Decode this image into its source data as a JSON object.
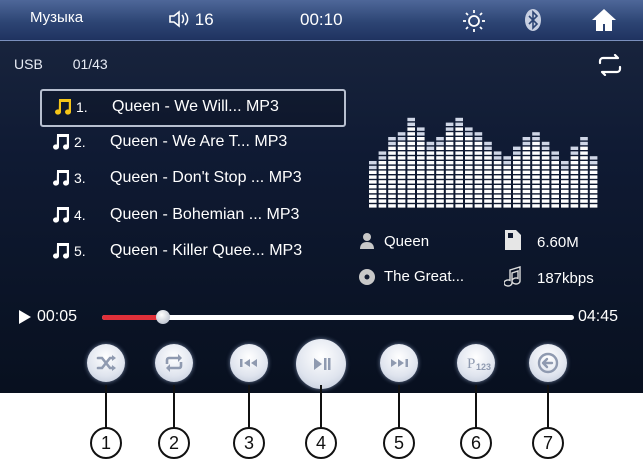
{
  "status_bar": {
    "title": "Музыка",
    "volume": "16",
    "time": "00:10",
    "icons": [
      "speaker-icon",
      "brightness-icon",
      "bluetooth-icon",
      "home-icon"
    ]
  },
  "source": {
    "name": "USB",
    "track_position": "01/43"
  },
  "playlist": [
    {
      "num": "1.",
      "title": "Queen - We Will... MP3",
      "selected": true
    },
    {
      "num": "2.",
      "title": "Queen - We Are T... MP3",
      "selected": false
    },
    {
      "num": "3.",
      "title": "Queen - Don't Stop ... MP3",
      "selected": false
    },
    {
      "num": "4.",
      "title": "Queen - Bohemian ... MP3",
      "selected": false
    },
    {
      "num": "5.",
      "title": "Queen - Killer Quee... MP3",
      "selected": false
    }
  ],
  "now_playing": {
    "artist": "Queen",
    "album": "The Great...",
    "file_size": "6.60M",
    "bitrate": "187kbps"
  },
  "progress": {
    "elapsed": "00:05",
    "total": "04:45",
    "fraction": 0.13
  },
  "controls": [
    {
      "name": "shuffle-button",
      "icon": "shuffle-icon",
      "callout": "1"
    },
    {
      "name": "repeat-button",
      "icon": "repeat-icon",
      "callout": "2"
    },
    {
      "name": "previous-button",
      "icon": "skip-back-icon",
      "callout": "3"
    },
    {
      "name": "play-pause-button",
      "icon": "play-pause-icon",
      "callout": "4"
    },
    {
      "name": "next-button",
      "icon": "skip-forward-icon",
      "callout": "5"
    },
    {
      "name": "number-input-button",
      "icon": "p123-icon",
      "label": "P123",
      "callout": "6"
    },
    {
      "name": "back-button",
      "icon": "back-arrow-icon",
      "callout": "7"
    }
  ],
  "colors": {
    "accent_progress": "#e0303a",
    "note_selected": "#f5c518"
  }
}
